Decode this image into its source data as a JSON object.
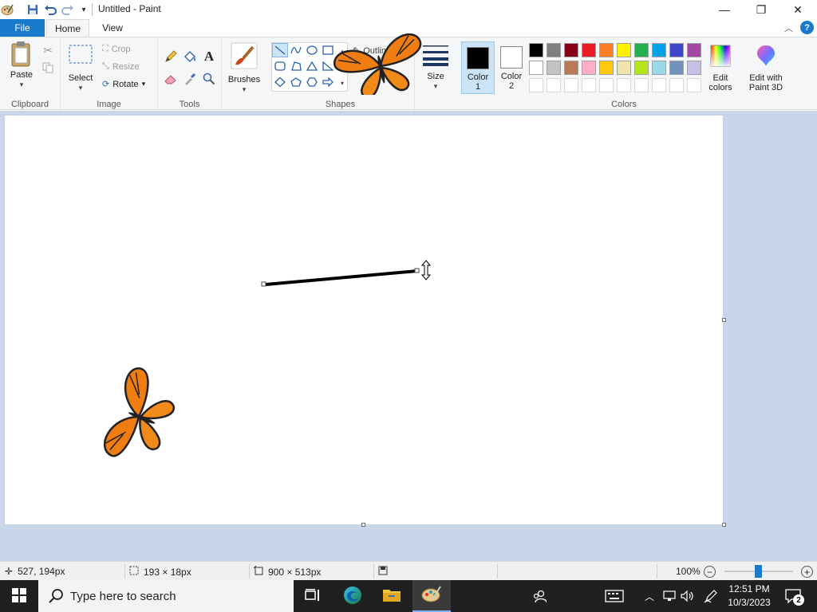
{
  "window": {
    "title": "Untitled - Paint",
    "minimize": "—",
    "maximize": "❐",
    "close": "✕"
  },
  "ribbon_tabs": {
    "file": "File",
    "home": "Home",
    "view": "View"
  },
  "clipboard": {
    "paste": "Paste",
    "group_label": "Clipboard"
  },
  "image": {
    "select": "Select",
    "crop": "Crop",
    "resize": "Resize",
    "rotate": "Rotate",
    "group_label": "Image"
  },
  "tools": {
    "group_label": "Tools"
  },
  "brushes": {
    "label": "Brushes"
  },
  "shapes": {
    "outline": "Outline",
    "group_label": "Shapes"
  },
  "size": {
    "label": "Size"
  },
  "colors": {
    "color1_label_line1": "Color",
    "color1_label_line2": "1",
    "color2_label_line1": "Color",
    "color2_label_line2": "2",
    "color1_value": "#000000",
    "color2_value": "#ffffff",
    "edit_colors_line1": "Edit",
    "edit_colors_line2": "colors",
    "paint3d_line1": "Edit with",
    "paint3d_line2": "Paint 3D",
    "group_label": "Colors",
    "palette_row1": [
      "#000000",
      "#7f7f7f",
      "#880015",
      "#ed1c24",
      "#ff7f27",
      "#fff200",
      "#22b14c",
      "#00a2e8",
      "#3f48cc",
      "#a349a4"
    ],
    "palette_row2": [
      "#ffffff",
      "#c3c3c3",
      "#b97a57",
      "#ffaec9",
      "#ffc90e",
      "#efe4b0",
      "#b5e61d",
      "#99d9ea",
      "#7092be",
      "#c8bfe7"
    ],
    "palette_row3": [
      "#ffffff",
      "#ffffff",
      "#ffffff",
      "#ffffff",
      "#ffffff",
      "#ffffff",
      "#ffffff",
      "#ffffff",
      "#ffffff",
      "#ffffff"
    ]
  },
  "status": {
    "cursor_pos": "527, 194px",
    "selection_size": "193 × 18px",
    "canvas_size": "900 × 513px",
    "zoom": "100%"
  },
  "taskbar": {
    "search_placeholder": "Type here to search",
    "time": "12:51 PM",
    "date": "10/3/2023",
    "notifications": "2"
  }
}
